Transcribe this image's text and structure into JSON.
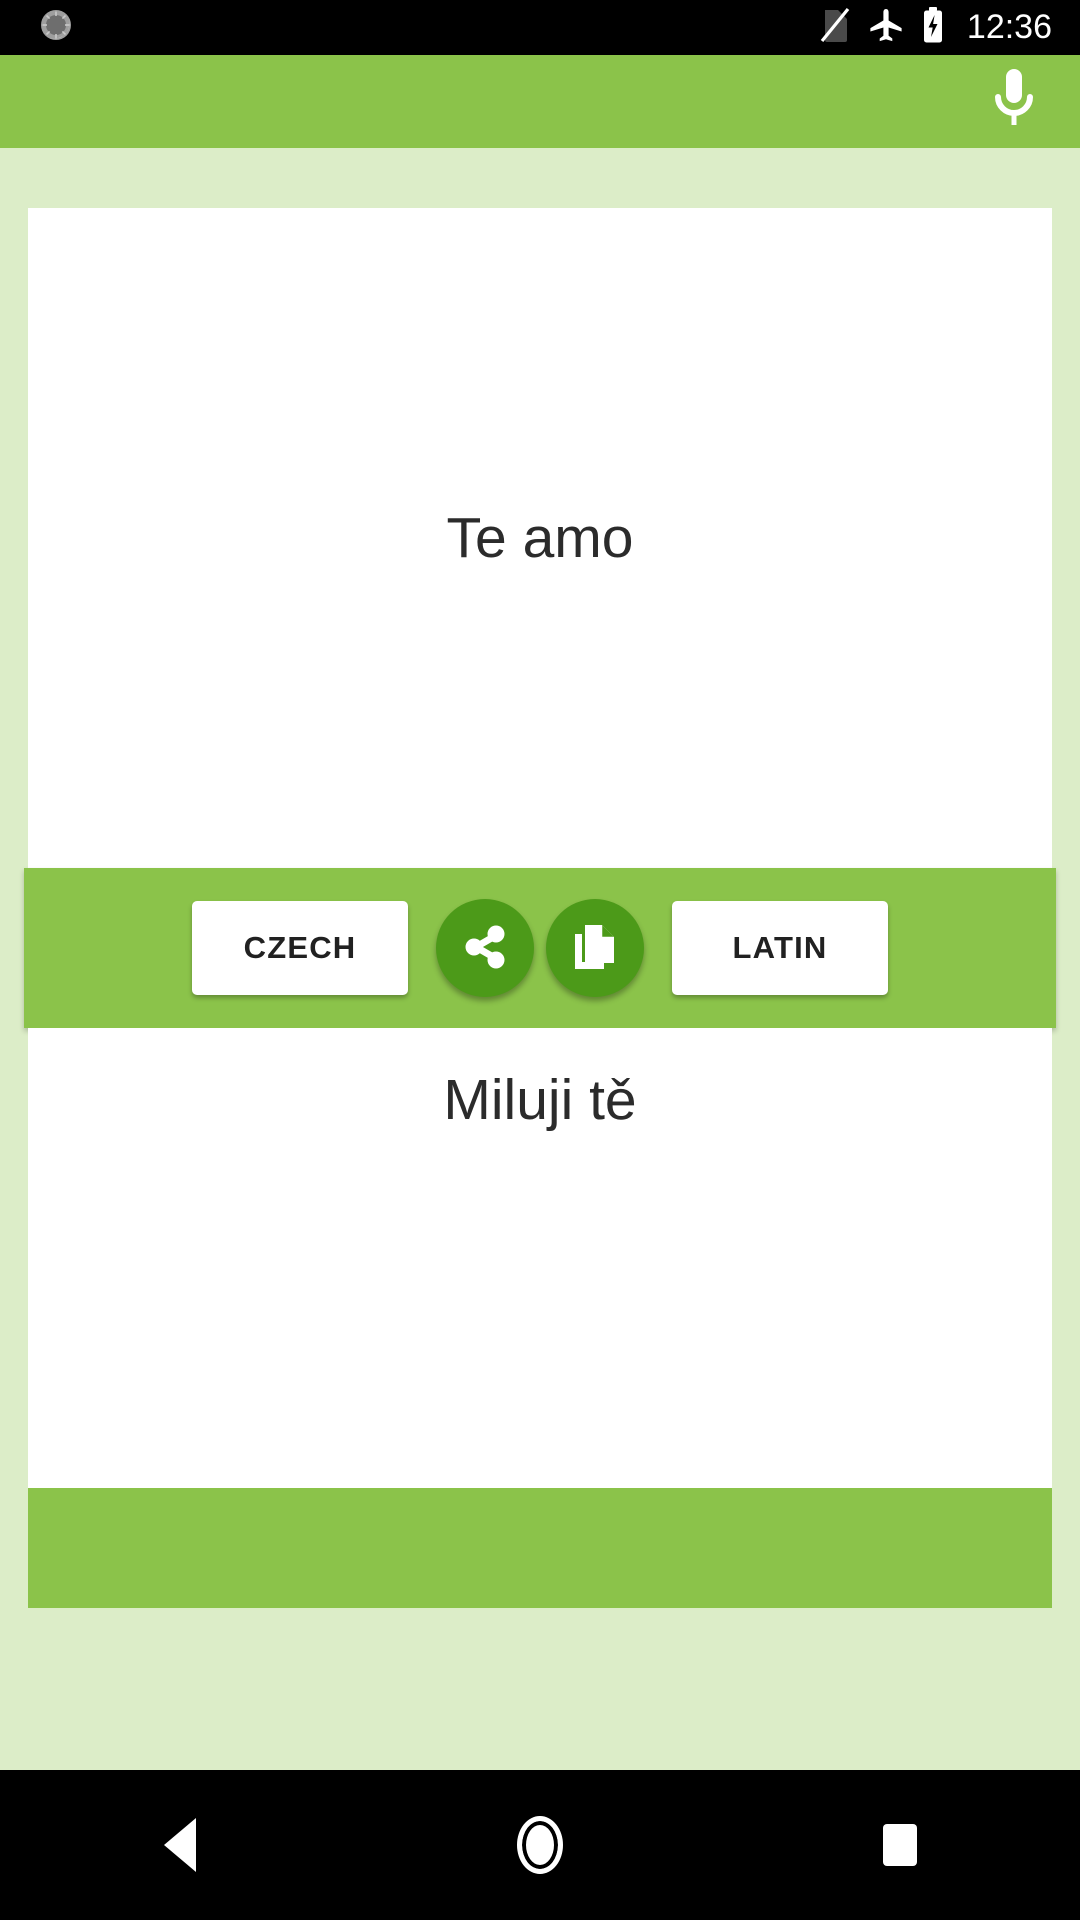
{
  "status_bar": {
    "notification_icon": "brightness-circle-icon",
    "icons": [
      "no-sim-icon",
      "airplane-mode-icon",
      "battery-charging-icon"
    ],
    "clock": "12:36"
  },
  "app_bar": {
    "mic_icon": "microphone-icon",
    "background_color": "#8BC34A"
  },
  "translation": {
    "source_text": "Te amo",
    "target_text": "Miluji tě"
  },
  "action_bar": {
    "source_language_label": "CZECH",
    "target_language_label": "LATIN",
    "share_icon": "share-icon",
    "copy_icon": "copy-icon",
    "button_color": "#4C9A19",
    "bar_color": "#8BC34A"
  },
  "navigation_bar": {
    "back_icon": "back-triangle-icon",
    "home_icon": "home-circle-icon",
    "recents_icon": "recents-square-icon"
  },
  "theme": {
    "page_background": "#DCEDC8",
    "card_background": "#FFFFFF",
    "text_color": "#2b2b2b"
  }
}
